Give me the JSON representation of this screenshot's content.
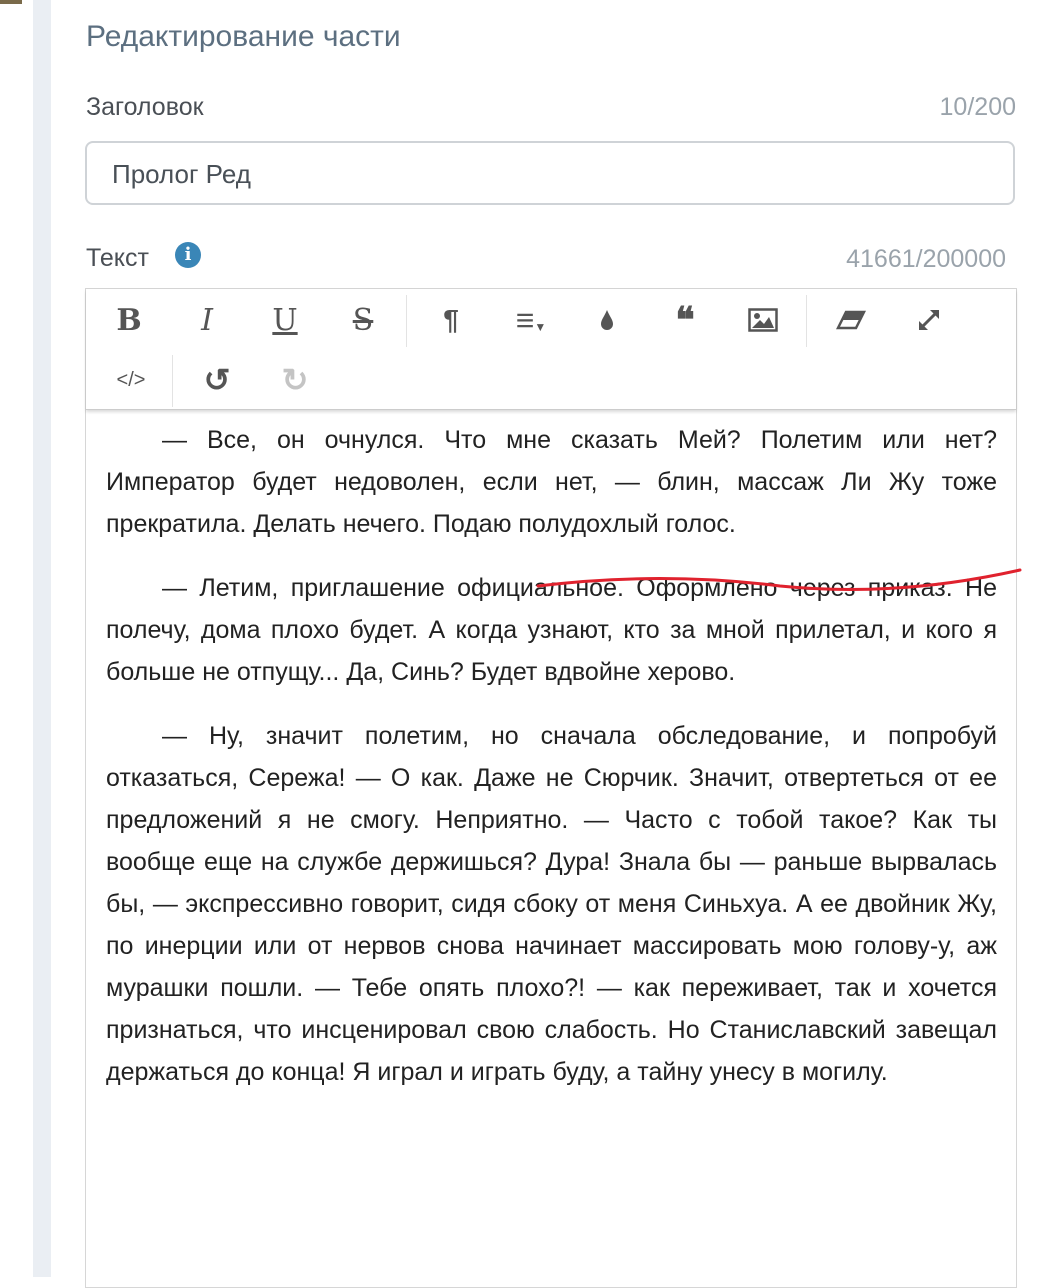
{
  "page_title": "Редактирование части",
  "heading_field": {
    "label": "Заголовок",
    "counter": "10/200",
    "value": "Пролог Ред"
  },
  "text_field": {
    "label": "Текст",
    "counter": "41661/200000"
  },
  "toolbar": {
    "bold": "B",
    "italic": "I",
    "underline": "U",
    "strike": "S",
    "paragraph": "¶",
    "align": "≡",
    "color": "color-drop-icon",
    "quote": "❝",
    "image": "image-icon",
    "eraser": "eraser-icon",
    "fullscreen": "expand-icon",
    "code": "</>",
    "undo": "↺",
    "redo": "↻"
  },
  "paragraphs": [
    "— Все, он очнулся. Что мне сказать Мей? Полетим или нет? Император будет недоволен, если нет, — блин, массаж Ли Жу тоже прекратила. Делать нечего. Подаю полудохлый голос.",
    "— Летим, приглашение официальное. Оформлено через приказ. Не полечу, дома плохо будет. А когда узнают, кто за мной прилетал, и кого я больше не отпущу... Да, Синь? Будет вдвойне херово.",
    "— Ну, значит полетим, но сначала обследование, и попробуй отказаться, Сережа! — О как. Даже не Сюрчик. Значит, отвертеться от ее предложений я не смогу. Неприятно. — Часто с тобой такое? Как ты вообще еще на службе держишься? Дура! Знала бы — раньше вырвалась бы, — экспрессивно говорит, сидя сбоку от меня Синьхуа. А ее двойник Жу, по инерции или от нервов снова начинает массировать мою голову-у, аж мурашки пошли. — Тебе опять плохо?! — как переживает, так и хочется признаться, что инсценировал свою слабость. Но Станиславский завещал держаться до конца! Я играл и играть буду, а тайну унесу в могилу."
  ],
  "colors": {
    "accent": "#3a86b7",
    "annotation": "#e0222e"
  }
}
